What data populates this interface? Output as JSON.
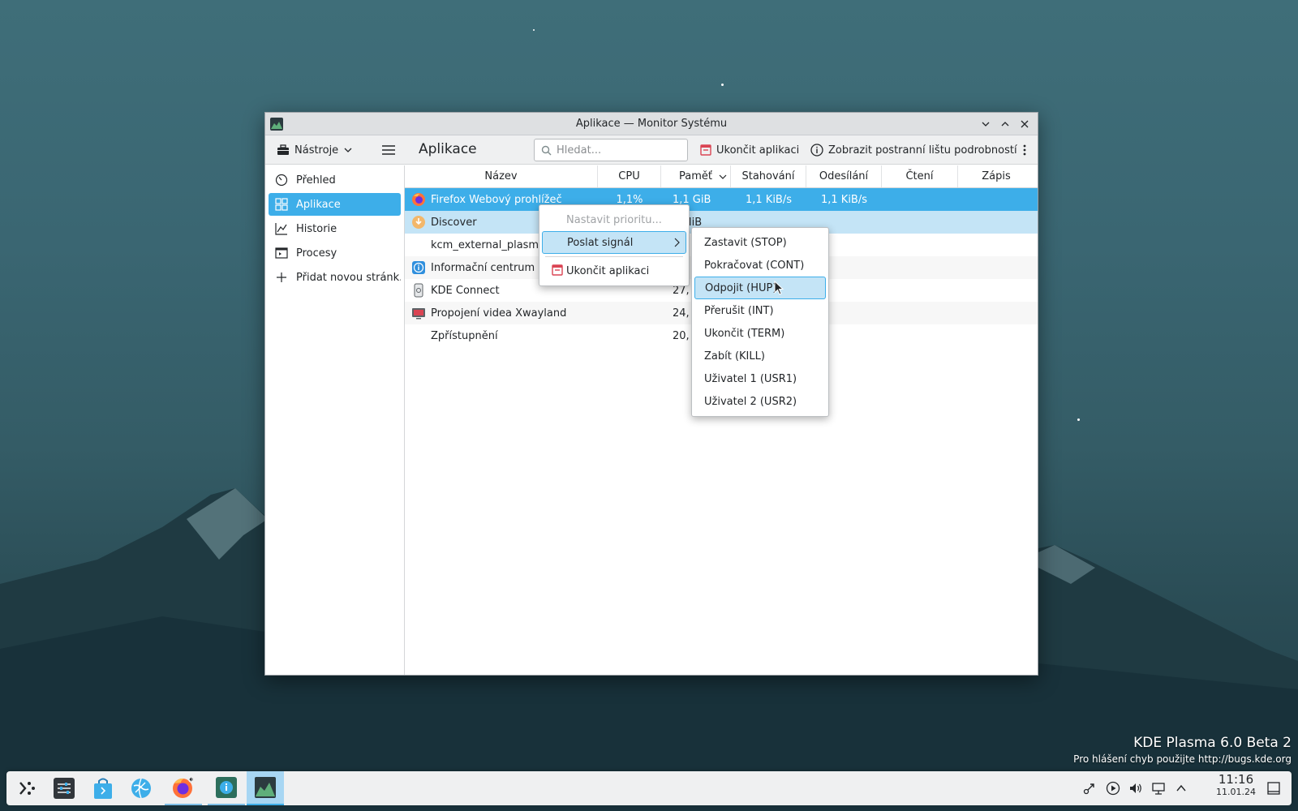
{
  "window": {
    "title": "Aplikace — Monitor Systému"
  },
  "toolbar": {
    "tools_label": "Nástroje",
    "page_title": "Aplikace",
    "search_placeholder": "Hledat...",
    "end_app_label": "Ukončit aplikaci",
    "sidebar_toggle_label": "Zobrazit postranní lištu podrobností"
  },
  "sidebar": {
    "items": [
      {
        "label": "Přehled"
      },
      {
        "label": "Aplikace"
      },
      {
        "label": "Historie"
      },
      {
        "label": "Procesy"
      },
      {
        "label": "Přidat novou stránk..."
      }
    ]
  },
  "table": {
    "columns": [
      "Název",
      "CPU",
      "Paměť",
      "Stahování",
      "Odesílání",
      "Čtení",
      "Zápis"
    ],
    "rows": [
      {
        "name": "Firefox Webový prohlížeč",
        "cpu": "1,1%",
        "mem": "1,1 GiB",
        "down": "1,1 KiB/s",
        "up": "1,1 KiB/s"
      },
      {
        "name": "Discover",
        "cpu": "",
        "mem": "0 MiB",
        "down": "",
        "up": ""
      },
      {
        "name": "kcm_external_plasma-s",
        "cpu": "",
        "mem": "",
        "down": "",
        "up": ""
      },
      {
        "name": "Informační centrum",
        "cpu": "",
        "mem": "",
        "down": "",
        "up": ""
      },
      {
        "name": "KDE Connect",
        "cpu": "",
        "mem": "27,",
        "down": "",
        "up": ""
      },
      {
        "name": "Propojení videa Xwayland",
        "cpu": "",
        "mem": "24,",
        "down": "",
        "up": ""
      },
      {
        "name": "Zpřístupnění",
        "cpu": "",
        "mem": "20,",
        "down": "",
        "up": ""
      }
    ]
  },
  "context_menu": {
    "set_priority": "Nastavit prioritu...",
    "send_signal": "Poslat signál",
    "end_app": "Ukončit aplikaci"
  },
  "signal_menu": {
    "items": [
      "Zastavit (STOP)",
      "Pokračovat (CONT)",
      "Odpojit (HUP)",
      "Přerušit (INT)",
      "Ukončit (TERM)",
      "Zabít (KILL)",
      "Uživatel 1 (USR1)",
      "Uživatel 2 (USR2)"
    ]
  },
  "desktop": {
    "watermark_title": "KDE Plasma 6.0 Beta 2",
    "watermark_sub": "Pro hlášení chyb použijte http://bugs.kde.org"
  },
  "taskbar": {
    "time": "11:16",
    "date": "11.01.24"
  },
  "colors": {
    "accent": "#3daee9",
    "hover": "#c4e4f6",
    "window_bg": "#ffffff",
    "chrome_bg": "#eff0f1"
  }
}
